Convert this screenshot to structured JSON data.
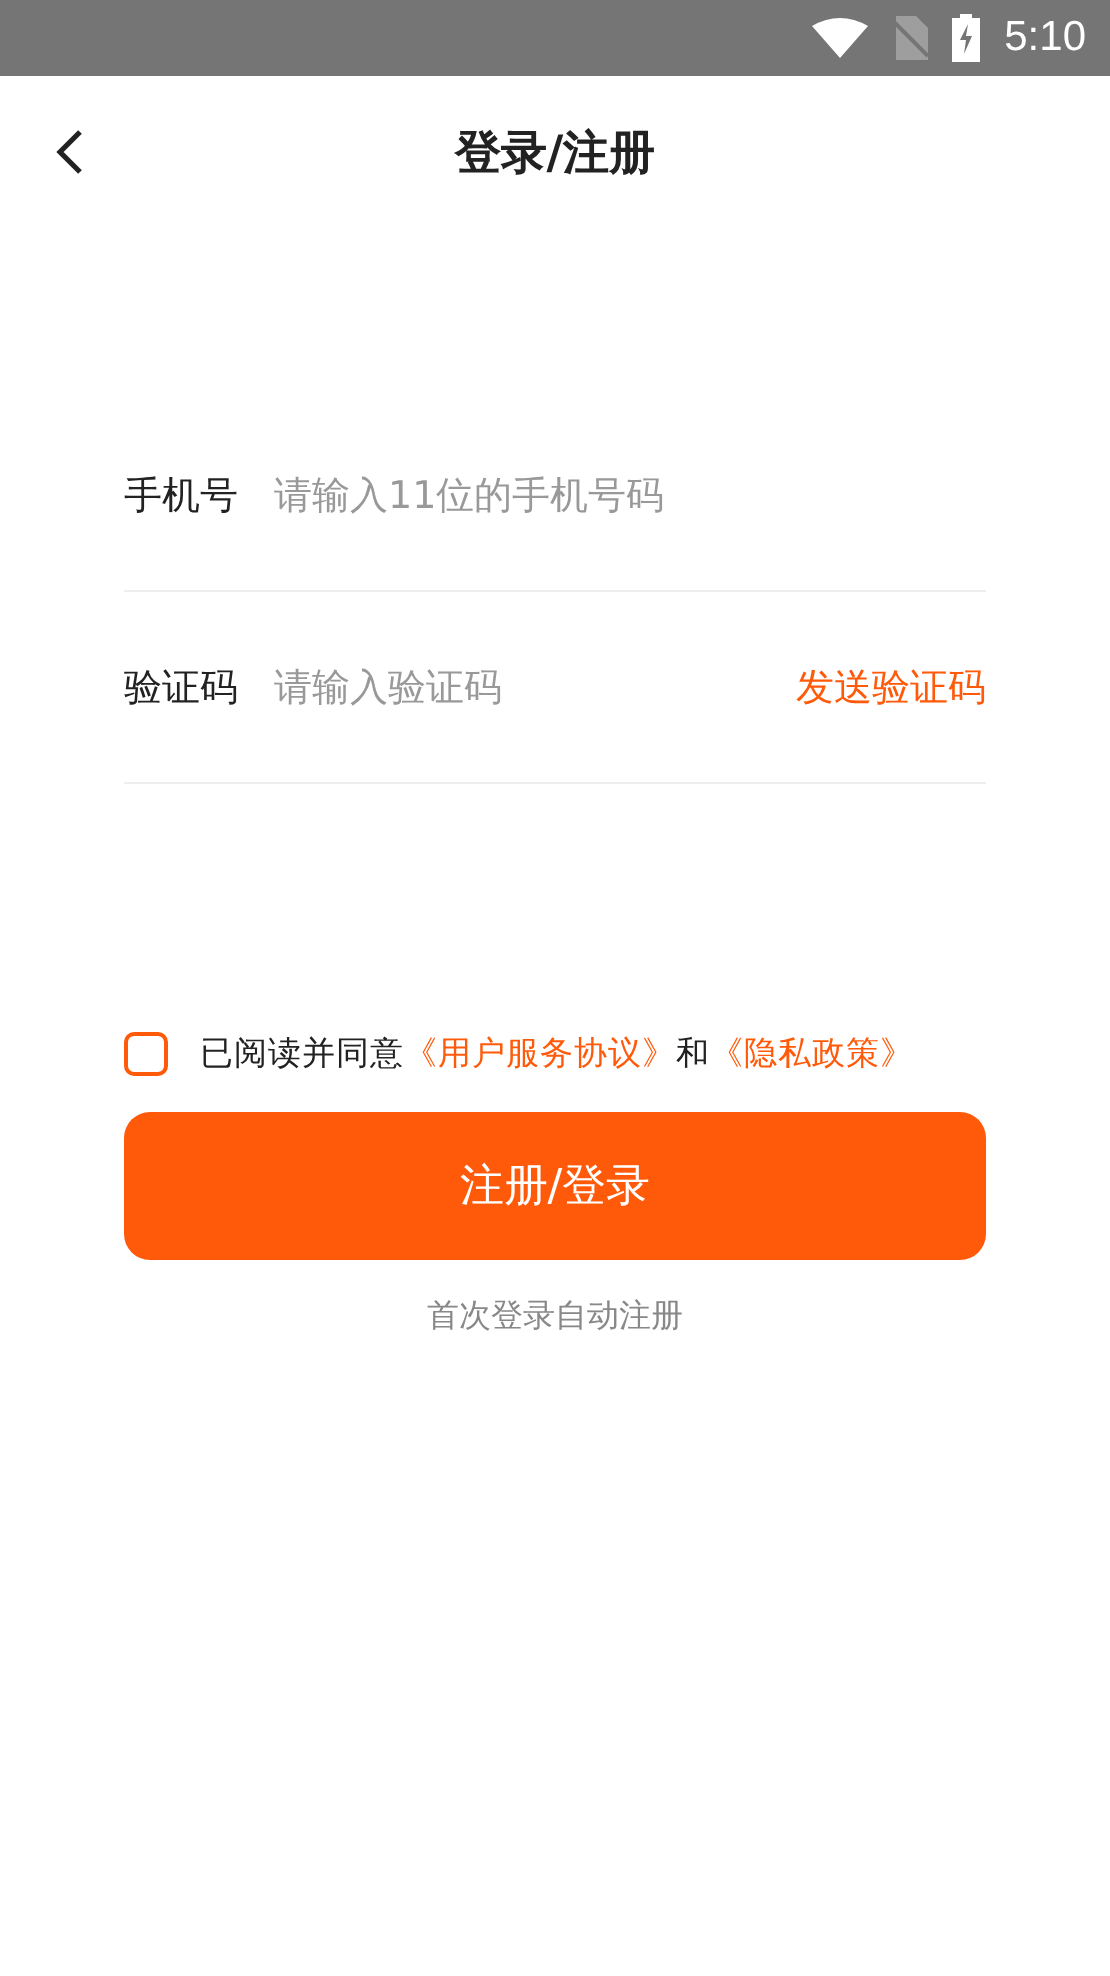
{
  "status_bar": {
    "time": "5:10"
  },
  "header": {
    "title": "登录/注册"
  },
  "fields": [
    {
      "label": "手机号",
      "placeholder": "请输入11位的手机号码"
    },
    {
      "label": "验证码",
      "placeholder": "请输入验证码",
      "action": "发送验证码"
    }
  ],
  "agreement": {
    "checked": false,
    "prefix": "已阅读并同意",
    "links": [
      "《用户服务协议》",
      "《隐私政策》"
    ],
    "joiner": "和"
  },
  "submit": "注册/登录",
  "hint": "首次登录自动注册"
}
